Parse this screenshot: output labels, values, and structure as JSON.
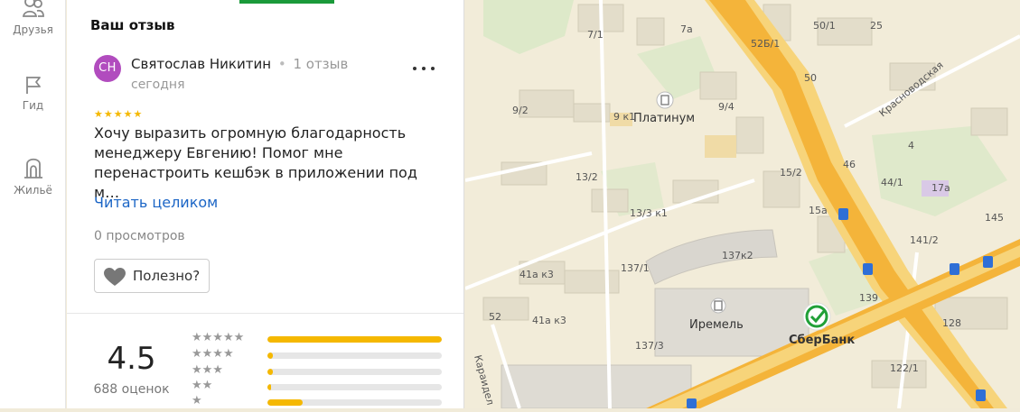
{
  "nav": {
    "items": [
      {
        "label": "Друзья",
        "icon": "friends-icon"
      },
      {
        "label": "Гид",
        "icon": "flag-icon"
      },
      {
        "label": "Жильё",
        "icon": "housing-icon"
      }
    ]
  },
  "review_panel": {
    "title": "Ваш отзыв",
    "author": {
      "initials": "СН",
      "name": "Святослав Никитин",
      "separator": "•",
      "review_count": "1 отзыв",
      "date": "сегодня",
      "avatar_color": "#b14cbe"
    },
    "rating_stars": 5,
    "stars_text": "★★★★★",
    "text": "Хочу выразить огромную благодарность менеджеру Евгению! Помог мне перенастроить кешбэк в приложении под м…",
    "read_more": "Читать целиком",
    "views": "0 просмотров",
    "useful_label": "Полезно?"
  },
  "rating_summary": {
    "value": "4.5",
    "count": "688 оценок",
    "distribution": [
      {
        "stars": "★★★★★",
        "fraction": 1.0
      },
      {
        "stars": "★★★★",
        "fraction": 0.03
      },
      {
        "stars": "★★★",
        "fraction": 0.03
      },
      {
        "stars": "★★",
        "fraction": 0.02
      },
      {
        "stars": "★",
        "fraction": 0.2
      }
    ],
    "accent": "#f5b800"
  },
  "map": {
    "street_labels": [
      "Красноводская",
      "Караидел"
    ],
    "building_labels": [
      "7/1",
      "7а",
      "50/1",
      "25",
      "52Б/1",
      "50",
      "9/2",
      "9 к1",
      "9/4",
      "13/2",
      "13/3 к1",
      "15/2",
      "15а",
      "46",
      "44/1",
      "4",
      "17а",
      "145",
      "141/2",
      "137/1",
      "137к2",
      "41а к3",
      "41а к3",
      "52",
      "139",
      "137/3",
      "128",
      "122/1"
    ],
    "poi": [
      {
        "name": "Платинум",
        "icon": "building-icon"
      },
      {
        "name": "Иремель",
        "icon": "building-icon"
      },
      {
        "name": "СберБанк",
        "icon": "sberbank-logo-icon"
      }
    ]
  }
}
